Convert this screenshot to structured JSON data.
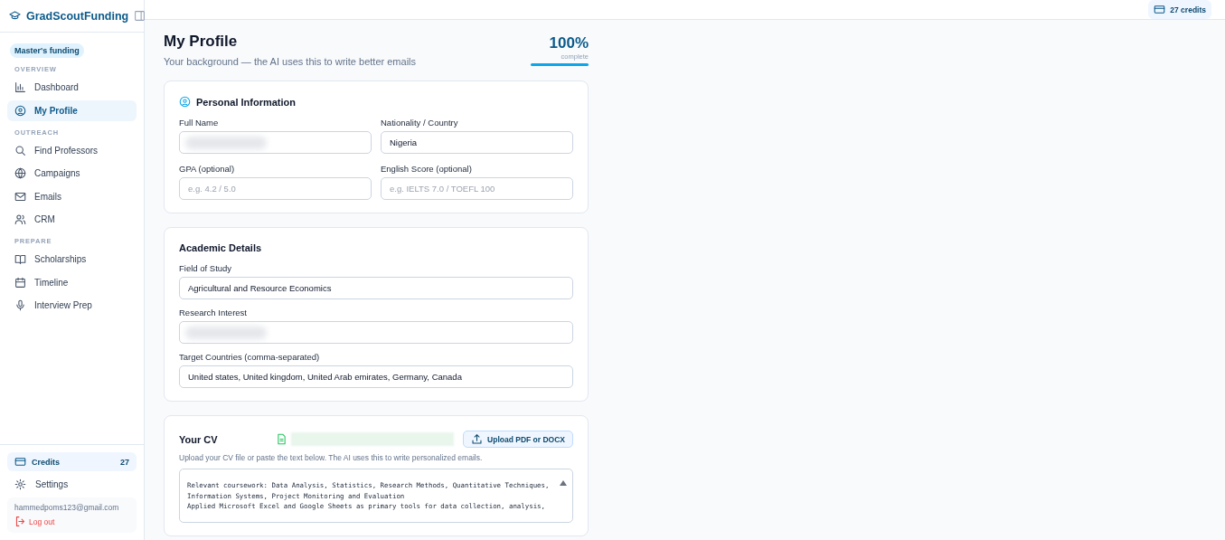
{
  "sidebar": {
    "brand": "GradScoutFunding",
    "badge": "Master's funding",
    "sections": [
      {
        "heading": "OVERVIEW",
        "items": [
          {
            "label": "Dashboard",
            "selected": false
          },
          {
            "label": "My Profile",
            "selected": true
          }
        ]
      },
      {
        "heading": "OUTREACH",
        "items": [
          {
            "label": "Find Professors",
            "selected": false
          },
          {
            "label": "Campaigns",
            "selected": false
          },
          {
            "label": "Emails",
            "selected": false
          },
          {
            "label": "CRM",
            "selected": false
          }
        ]
      },
      {
        "heading": "PREPARE",
        "items": [
          {
            "label": "Scholarships",
            "selected": false
          },
          {
            "label": "Timeline",
            "selected": false
          },
          {
            "label": "Interview Prep",
            "selected": false
          }
        ]
      }
    ],
    "credits": {
      "label": "Credits",
      "count": "27"
    },
    "settings": "Settings",
    "account": {
      "email": "hammedpoms123@gmail.com",
      "logout": "Log out"
    }
  },
  "topbar": {
    "credits": "27 credits"
  },
  "page": {
    "title": "My Profile",
    "subtitle": "Your background — the AI uses this to write better emails",
    "completion": {
      "percent": "100%",
      "caption": "complete",
      "level": 1
    }
  },
  "personal": {
    "title": "Personal Information",
    "fields": [
      {
        "label": "Full Name",
        "redacted": true
      },
      {
        "label": "Nationality / Country",
        "value": "Nigeria"
      },
      {
        "label": "GPA (optional)",
        "placeholder": "e.g. 4.2 / 5.0"
      },
      {
        "label": "English Score (optional)",
        "placeholder": "e.g. IELTS 7.0 / TOEFL 100"
      }
    ]
  },
  "academic": {
    "title": "Academic Details",
    "fields": [
      {
        "label": "Field of Study",
        "value": "Agricultural and Resource Economics"
      },
      {
        "label": "Research Interest",
        "redacted": true
      },
      {
        "label": "Target Countries (comma-separated)",
        "value": "United states, United kingdom, United Arab emirates, Germany, Canada"
      }
    ]
  },
  "cv": {
    "title": "Your CV",
    "upload_button": "Upload PDF or DOCX",
    "hint": "Upload your CV file or paste the text below. The AI uses this to write personalized emails.",
    "lines": [
      "Relevant coursework: Data Analysis, Statistics, Research Methods, Quantitative Techniques,",
      "Information Systems, Project Monitoring and Evaluation",
      "Applied Microsoft Excel and Google Sheets as primary tools for data collection, analysis,"
    ]
  }
}
